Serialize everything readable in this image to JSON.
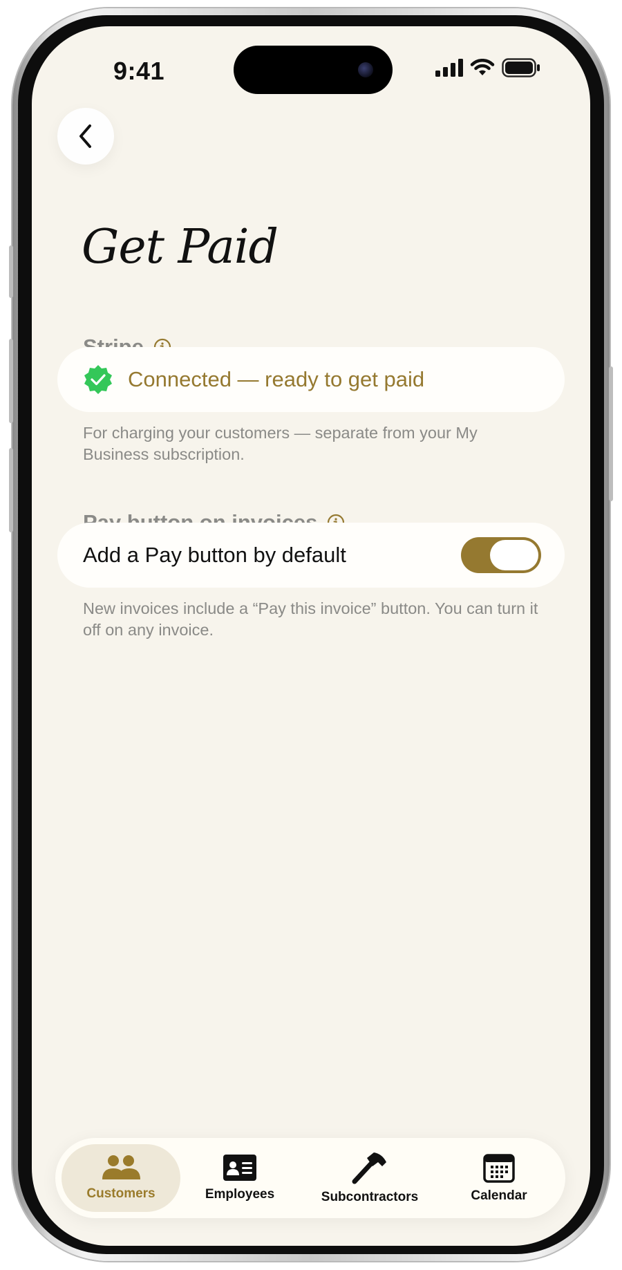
{
  "status_bar": {
    "time": "9:41"
  },
  "header": {
    "back_label": "Back",
    "title": "Get Paid"
  },
  "stripe": {
    "section_label": "Stripe",
    "status_text": "Connected — ready to get paid",
    "help_text": "For charging your customers — separate from your My Business subscription."
  },
  "pay_button": {
    "section_label": "Pay button on invoices",
    "row_label": "Add a Pay button by default",
    "toggle_on": true,
    "help_text": "New invoices include a “Pay this invoice” button. You can turn it off on any invoice."
  },
  "tabs": [
    {
      "label": "Customers",
      "icon": "people-icon",
      "active": true
    },
    {
      "label": "Employees",
      "icon": "id-card-icon",
      "active": false
    },
    {
      "label": "Subcontractors",
      "icon": "hammer-icon",
      "active": false
    },
    {
      "label": "Calendar",
      "icon": "calendar-icon",
      "active": false
    }
  ],
  "colors": {
    "accent": "#957930",
    "background": "#f7f4ec",
    "success": "#34c759",
    "muted_text": "#8a8a87"
  }
}
